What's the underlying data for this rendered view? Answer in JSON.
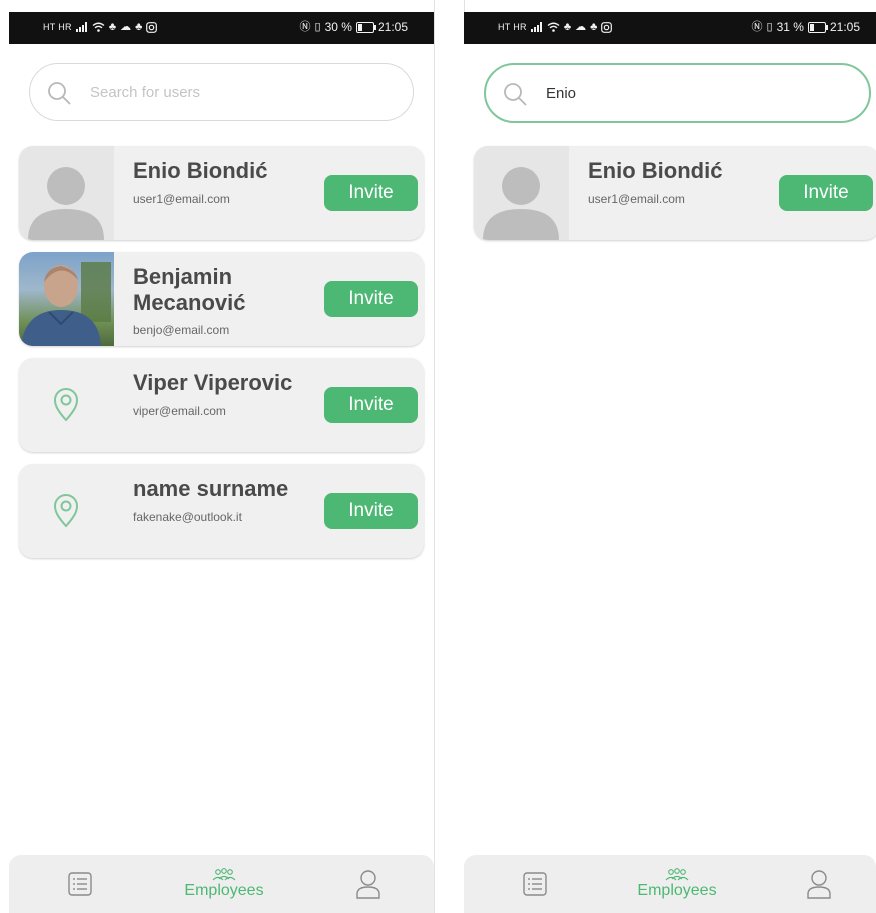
{
  "colors": {
    "accent": "#4cb874",
    "search_focus": "#7fc79a",
    "card_bg": "#f0f0f0",
    "statusbar_bg": "#111111"
  },
  "left_screen": {
    "status_bar": {
      "carrier": "HT HR",
      "battery_percent": "30 %",
      "battery_level": 0.3,
      "time": "21:05"
    },
    "search": {
      "placeholder": "Search for users",
      "value": ""
    },
    "users": [
      {
        "name": "Enio Biondić",
        "email": "user1@email.com",
        "avatar": "default-avatar",
        "invite_label": "Invite"
      },
      {
        "name": "Benjamin Mecanović",
        "email": "benjo@email.com",
        "avatar": "photo",
        "invite_label": "Invite"
      },
      {
        "name": "Viper Viperovic",
        "email": "viper@email.com",
        "avatar": "location-pin-icon",
        "invite_label": "Invite"
      },
      {
        "name": "name surname",
        "email": "fakenake@outlook.it",
        "avatar": "location-pin-icon",
        "invite_label": "Invite"
      }
    ],
    "nav": {
      "active_label": "Employees"
    }
  },
  "right_screen": {
    "status_bar": {
      "carrier": "HT HR",
      "battery_percent": "31 %",
      "battery_level": 0.31,
      "time": "21:05"
    },
    "search": {
      "placeholder": "Search for users",
      "value": "Enio"
    },
    "users": [
      {
        "name": "Enio Biondić",
        "email": "user1@email.com",
        "avatar": "default-avatar",
        "invite_label": "Invite"
      }
    ],
    "nav": {
      "active_label": "Employees"
    }
  },
  "icons": [
    "signal-icon",
    "wifi-icon",
    "notification-icon",
    "nfc-icon",
    "vibrate-icon",
    "battery-icon",
    "search-icon",
    "list-icon",
    "employees-icon",
    "profile-icon"
  ]
}
